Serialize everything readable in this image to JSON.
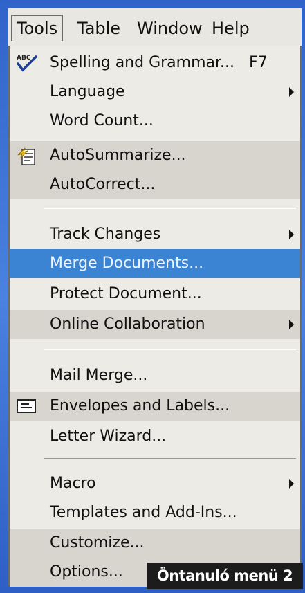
{
  "menubar": {
    "items": [
      "Tools",
      "Table",
      "Window",
      "Help"
    ]
  },
  "menu": {
    "spelling": {
      "label": "Spelling and Grammar...",
      "shortcut": "F7"
    },
    "language": "Language",
    "word_count": "Word Count...",
    "autosummarize": "AutoSummarize...",
    "autocorrect": "AutoCorrect...",
    "track_changes": "Track Changes",
    "merge_documents": "Merge Documents...",
    "protect_document": "Protect Document...",
    "online_collaboration": "Online Collaboration",
    "mail_merge": "Mail Merge...",
    "envelopes": "Envelopes and Labels...",
    "letter_wizard": "Letter Wizard...",
    "macro": "Macro",
    "templates": "Templates and Add-Ins...",
    "customize": "Customize...",
    "options": "Options..."
  },
  "caption": "Öntanuló menü 2",
  "colors": {
    "highlight": "#3b83d3",
    "menu_bg": "#ecebe6",
    "menu_alt_bg": "#d7d5cd",
    "frame_blue": "#3d6fd0"
  }
}
